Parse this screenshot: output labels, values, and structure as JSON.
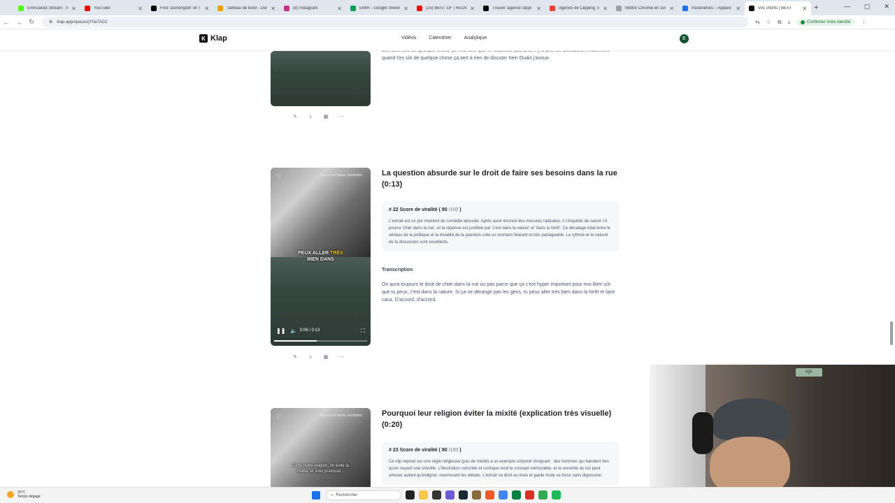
{
  "browser": {
    "tabs": [
      {
        "label": "Emiruskick Stream - W",
        "color": "#53fc18"
      },
      {
        "label": "YouTube",
        "color": "#ff0000"
      },
      {
        "label": "Find 'asmongold' on T",
        "color": "#000000"
      },
      {
        "label": "Tableau de bord - Dom",
        "color": "#f59e0b"
      },
      {
        "label": "(8) Instagram",
        "color": "#c13584"
      },
      {
        "label": "EMIR - Google Sheets",
        "color": "#0f9d58"
      },
      {
        "label": "(25) BEST OF | REDIFF",
        "color": "#ff0000"
      },
      {
        "label": "Trouve 'agence clippi",
        "color": "#000000"
      },
      {
        "label": "Agence de Clipping Ti",
        "color": "#ea4335"
      },
      {
        "label": "Mettre Chrome en sor",
        "color": "#9aa0a6"
      },
      {
        "label": "Paramètres – Appare",
        "color": "#1a73e8"
      },
      {
        "label": "Vos shorts | BEST",
        "color": "#111111",
        "active": true
      }
    ],
    "new_tab_symbol": "+",
    "url": "klap.app/spaces/jY0aTAG2",
    "confirm_identity": "Confirmer votre identité"
  },
  "app": {
    "logo": "Klap",
    "logo_mark": "K",
    "nav": [
      "Vidéos",
      "Calendrier",
      "Analytique"
    ],
    "avatar_letter": "E"
  },
  "clips": [
    {
      "partial_text": "Les données au quelque chose ça veut dire que le rédacteur pas plus il y a plus de discussion finalement quand t'es sûr de quelque chose ça sert à rien de discuter hein Ouais j'avoue."
    },
    {
      "title": "La question absurde sur le droit de faire ses besoins dans la rue (0:13)",
      "score_prefix": "# 22 Score de viralité (",
      "score_value": "80",
      "score_suffix": "/100",
      "score_close": ")",
      "summary": "L'extrait est un pur moment de comédie absurde. Après avoir énoncé des mesures radicales, il s'inquiète de savoir s'il pourra 'chier dans la rue', et la réponse est justifiée par 'c'est dans la nature' et 'dans la forêt'. Ce décalage total entre le sérieux de la politique et la trivialité de la question crée un moment hilarant et très partageable. Le rythme et le naturel de la discussion sont excellents.",
      "transcription_label": "Transcription",
      "transcription": "On aura toujours le droit de chier dans la rue ou pas parce que ça c'est hyper important pour moi Bien sûr que tu peux, c'est dans la nature. Si ça ne dérange pas les gens, tu peux aller très bien dans la forêt et faire caca. D'accord, d'accord.",
      "video": {
        "lowres_label": "Aperçu en basse résolution",
        "caption_line1_a": "PEUX ALLER ",
        "caption_line1_b": "TRÈS",
        "caption_line2": "BIEN DANS",
        "time": "0:06 / 0:13",
        "progress": 0.46
      }
    },
    {
      "title": "Pourquoi leur religion éviter la mixité (explication très visuelle) (0:20)",
      "score_prefix": "# 23 Score de viralité (",
      "score_value": "80",
      "score_suffix": "/100",
      "score_close": ")",
      "summary": "Ce clip repose sur une règle religieuse (pas de mixité) à un exemple corporel choquant : des hommes qui bandent rien qu'en voyant une cheville. L'illustration concrète et comique rend le concept mémorable, et la sincérité du ton peut amuser autant qu'indigner, nourrissant les débats. L'extrait va droit au mais et garde toute sa force sans digression.",
      "video": {
        "lowres_label": "Aperçu en basse résolution",
        "caption_line1": "Dans notre religion, on évite la",
        "caption_line2": "mixité: et voici pourquoi..."
      }
    }
  ],
  "icons": {
    "edit": "✎",
    "download": "⤓",
    "calendar": "▦",
    "more": "⋯",
    "heart": "♡",
    "pause": "❚❚",
    "volume": "🔈",
    "fullscreen": "⛶",
    "search": "⌕"
  },
  "taskbar": {
    "weather_temp": "20°C",
    "weather_desc": "Temps dégagé",
    "search_placeholder": "Rechercher"
  },
  "webcam": {
    "tv_logo": "K[K"
  }
}
